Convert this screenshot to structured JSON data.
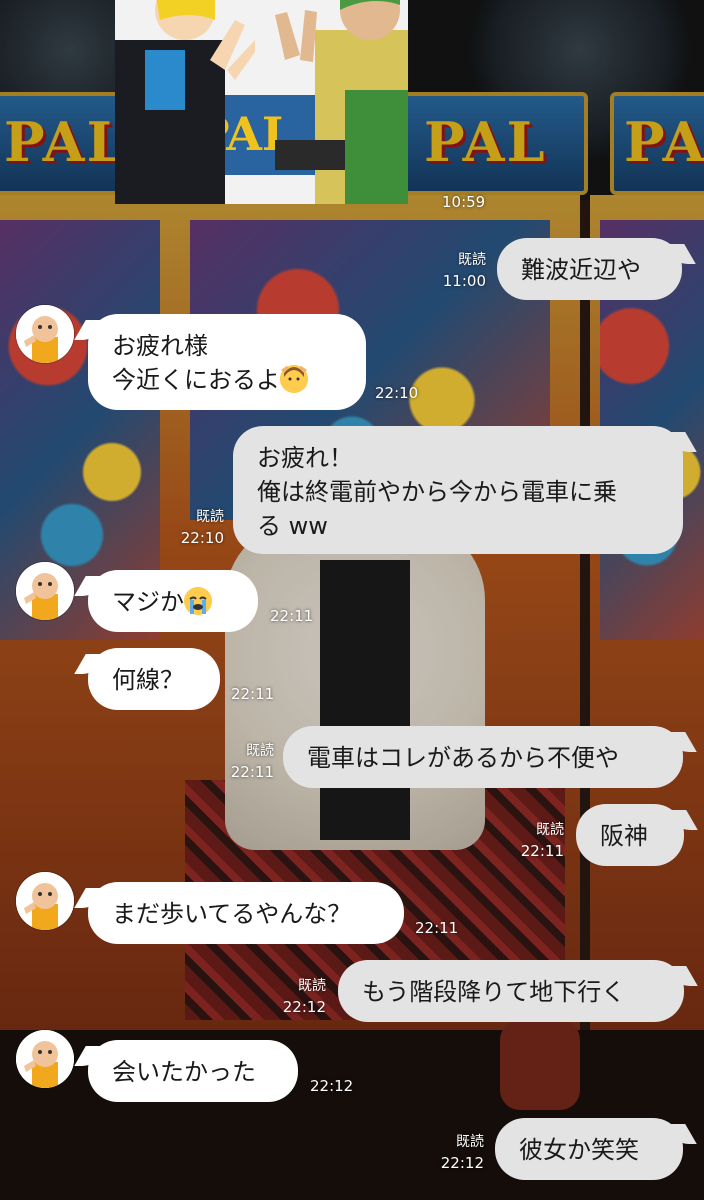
{
  "colors": {
    "incoming_bubble": "#ffffff",
    "outgoing_bubble": "#e3e3e3",
    "timestamp": "#ffffff"
  },
  "sticker": {
    "sign_text": "PAL"
  },
  "messages": [
    {
      "dir": "out",
      "text": "難波近辺や",
      "read": "既読",
      "time": "11:00"
    },
    {
      "dir": "in",
      "text": "お疲れ様\n今近くにおるよ",
      "emoji": "woman-gesturing-ok-icon",
      "time": "22:10"
    },
    {
      "dir": "out",
      "text": "お疲れ！\n俺は終電前やから今から電車に乗\nる ww",
      "read": "既読",
      "time": "22:10"
    },
    {
      "dir": "in",
      "text": "マジか",
      "emoji": "loudly-crying-face-icon",
      "time": "22:11"
    },
    {
      "dir": "in",
      "text": "何線？",
      "time": "22:11"
    },
    {
      "dir": "out",
      "text": "電車はコレがあるから不便や",
      "read": "既読",
      "time": "22:11"
    },
    {
      "dir": "out",
      "text": "阪神",
      "read": "既読",
      "time": "22:11"
    },
    {
      "dir": "in",
      "text": "まだ歩いてるやんな？",
      "time": "22:11"
    },
    {
      "dir": "out",
      "text": "もう階段降りて地下行く",
      "read": "既読",
      "time": "22:12"
    },
    {
      "dir": "in",
      "text": "会いたかった",
      "time": "22:12"
    },
    {
      "dir": "out",
      "text": "彼女か笑笑",
      "read": "既読",
      "time": "22:12"
    }
  ],
  "sticker_time": "10:59"
}
